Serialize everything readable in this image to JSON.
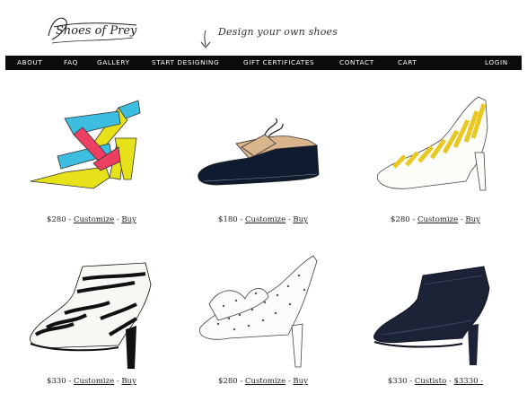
{
  "brand": {
    "logo_text": "Shoes of Prey",
    "tagline": "Design your own shoes"
  },
  "nav": {
    "items": [
      "ABOUT",
      "FAQ",
      "GALLERY",
      "START DESIGNING",
      "GIFT CERTIFICATES",
      "CONTACT",
      "CART"
    ],
    "login": "LOGIN"
  },
  "products": [
    {
      "price": "$280",
      "customize": "Customize",
      "sep": " - ",
      "buy": "Buy",
      "desc": "multicolor strappy sandal"
    },
    {
      "price": "$180",
      "customize": "Customize",
      "sep": " - ",
      "buy": "Buy",
      "desc": "navy and tan brogue"
    },
    {
      "price": "$280",
      "customize": "Customize",
      "sep": " - ",
      "buy": "Buy",
      "desc": "yellow striped peep toe pump"
    },
    {
      "price": "$330",
      "customize": "Customize",
      "sep": " - ",
      "buy": "Buy",
      "desc": "zebra print ankle boot"
    },
    {
      "price": "$280",
      "customize": "Customize",
      "sep": " - ",
      "buy": "Buy",
      "desc": "polka dot ruffle sandal"
    },
    {
      "price": "$330",
      "customize": "Custisto",
      "sep": " -",
      "buy": "$3330 -",
      "desc": "navy ankle boot"
    }
  ],
  "colors": {
    "nav_bg": "#0b0b0b",
    "nav_text": "#ffffff"
  }
}
